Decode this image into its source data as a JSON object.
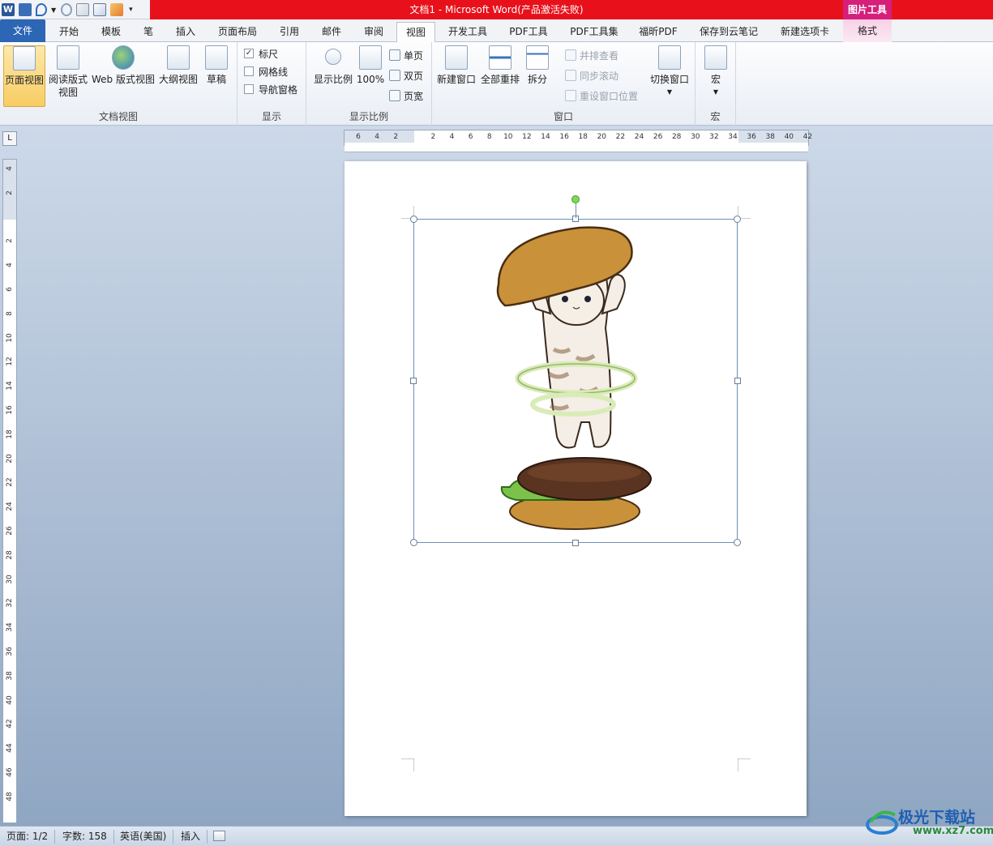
{
  "window": {
    "title": "文档1 - Microsoft Word(产品激活失败)",
    "context_tab_group": "图片工具"
  },
  "tabs": [
    {
      "label": "文件"
    },
    {
      "label": "开始"
    },
    {
      "label": "模板"
    },
    {
      "label": "笔"
    },
    {
      "label": "插入"
    },
    {
      "label": "页面布局"
    },
    {
      "label": "引用"
    },
    {
      "label": "邮件"
    },
    {
      "label": "审阅"
    },
    {
      "label": "视图"
    },
    {
      "label": "开发工具"
    },
    {
      "label": "PDF工具"
    },
    {
      "label": "PDF工具集"
    },
    {
      "label": "福昕PDF"
    },
    {
      "label": "保存到云笔记"
    },
    {
      "label": "新建选项卡"
    },
    {
      "label": "格式"
    }
  ],
  "ribbon": {
    "doc_views": {
      "label": "文档视图",
      "print_layout": "页面视图",
      "reading_a": "阅读版式",
      "reading_b": "视图",
      "web_layout": "Web 版式视图",
      "outline": "大纲视图",
      "draft": "草稿"
    },
    "show": {
      "label": "显示",
      "ruler": "标尺",
      "ruler_checked": true,
      "gridlines": "网格线",
      "nav_pane": "导航窗格"
    },
    "zoom": {
      "label": "显示比例",
      "zoom": "显示比例",
      "hundred": "100%",
      "one_page": "单页",
      "two_pages": "双页",
      "page_width": "页宽"
    },
    "window": {
      "label": "窗口",
      "new_window": "新建窗口",
      "arrange_all": "全部重排",
      "split": "拆分",
      "side_by_side": "并排查看",
      "sync_scroll": "同步滚动",
      "reset_pos": "重设窗口位置",
      "switch": "切换窗口"
    },
    "macros": {
      "label": "宏",
      "macros": "宏"
    }
  },
  "rulers": {
    "h_numbers": [
      "6",
      "4",
      "2",
      "2",
      "4",
      "6",
      "8",
      "10",
      "12",
      "14",
      "16",
      "18",
      "20",
      "22",
      "24",
      "26",
      "28",
      "30",
      "32",
      "34",
      "36",
      "38",
      "40",
      "42"
    ],
    "v_numbers": [
      "4",
      "2",
      "2",
      "4",
      "6",
      "8",
      "10",
      "12",
      "14",
      "16",
      "18",
      "20",
      "22",
      "24",
      "26",
      "28",
      "30",
      "32",
      "34",
      "36",
      "38",
      "40",
      "42",
      "44",
      "46",
      "48"
    ]
  },
  "statusbar": {
    "page": "页面: 1/2",
    "words": "字数: 158",
    "language": "英语(美国)",
    "mode": "插入"
  },
  "watermark": {
    "name": "极光下载站",
    "url": "www.xz7.com"
  }
}
